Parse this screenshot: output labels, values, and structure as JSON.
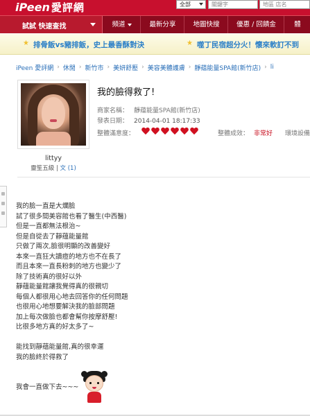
{
  "header": {
    "logo_text": "iPeen",
    "logo_text_cn": "愛評網",
    "search_category": "全部",
    "search_keyword_placeholder": "關鍵字",
    "search_place_placeholder": "地區 店名"
  },
  "nav": {
    "quick_search_label": "試試 快速查找",
    "items": [
      {
        "label": "頻道",
        "has_dropdown": true
      },
      {
        "label": "最新分享"
      },
      {
        "label": "地圖快搜"
      },
      {
        "label": "優惠 / 回饋金"
      },
      {
        "label": "體"
      }
    ]
  },
  "banner": {
    "left_text": "排骨飯vs豬排飯，史上最香酥對決",
    "right_text": "噬丁民宿超分火！懷來軟訂不到"
  },
  "breadcrumb": [
    "iPeen 愛評網",
    "休閒",
    "新竹市",
    "美妍舒壓",
    "美容美體護膚",
    "靜蕴能量SPA館(新竹店)",
    "li"
  ],
  "profile": {
    "username": "littyy",
    "level": "靈笙五級",
    "separator": "|",
    "articles": "文 (1)"
  },
  "post": {
    "title": "我的臉得救了!",
    "shop_label": "商家名稱：",
    "shop_name": "靜蕴能量SPA館(新竹店)",
    "date_label": "發表日期：",
    "date_value": "2014-04-01 18:17:33",
    "overall_label": "整體滿意度：",
    "hearts": 6,
    "result_label": "整體成效：",
    "result_value": "非常好",
    "env_label": "環境設備"
  },
  "body": {
    "lines": [
      "我的臉一直是大爛臉",
      "試了很多間美容館也看了醫生(中西醫)",
      "但是一直都無法根治~",
      "但是自從去了靜蕴能量館",
      "只做了兩次,臉很明顯的改善變好",
      "本來一直狂大讀痘的地方也不在長了",
      "而且本來一直長粉刺的地方也變少了",
      "除了技術真的很好以外",
      "靜蕴能量館讓我覺得真的很親切",
      "每個人都很用心地去回答你的任何問題",
      "也很用心地想要解決我的臉部問題",
      "加上每次做臉也都會幫你按摩舒壓!",
      "比很多地方真的好太多了~",
      "",
      "能找到靜蕴能量館,真的很幸運",
      "我的臉終於得救了",
      "",
      "",
      "我會一直做下去~~~"
    ]
  },
  "colors": {
    "brand_red": "#c8102e",
    "nav_dark": "#8b0a1e",
    "link_blue": "#2a6fb8",
    "heart_red": "#d01020"
  }
}
